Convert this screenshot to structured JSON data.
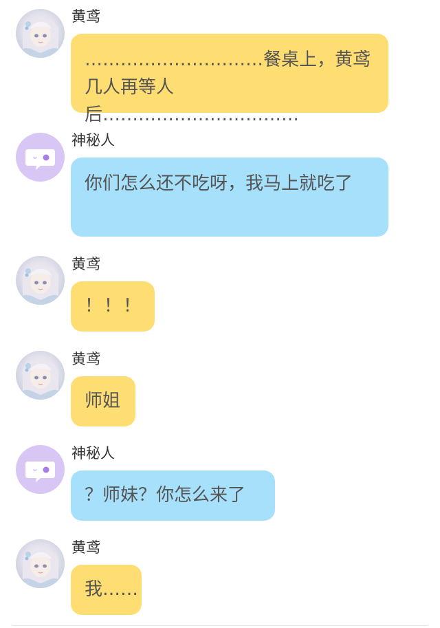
{
  "messages": [
    {
      "sender": "黄鸢",
      "avatar": "girl-avatar",
      "text": "…………………………餐桌上，黄鸢几人再等人后……………………………",
      "color": "#fedd72"
    },
    {
      "sender": "神秘人",
      "avatar": "mystery-chat-avatar",
      "text": "你们怎么还不吃呀，我马上就吃了",
      "color": "#a7e0fb"
    },
    {
      "sender": "黄鸢",
      "avatar": "girl-avatar",
      "text": "！！！",
      "color": "#fedd72"
    },
    {
      "sender": "黄鸢",
      "avatar": "girl-avatar",
      "text": "师姐",
      "color": "#fedd72"
    },
    {
      "sender": "神秘人",
      "avatar": "mystery-chat-avatar",
      "text": "？师妹？你怎么来了",
      "color": "#a7e0fb"
    },
    {
      "sender": "黄鸢",
      "avatar": "girl-avatar",
      "text": "我……",
      "color": "#fedd72"
    }
  ]
}
